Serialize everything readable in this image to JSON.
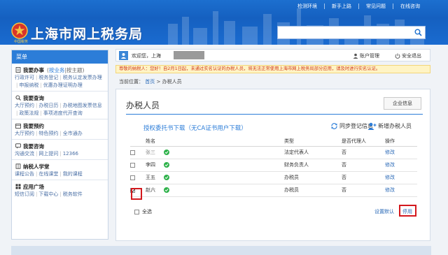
{
  "header": {
    "top_links": [
      "检测环境",
      "新手上路",
      "常见问题",
      "在线咨询"
    ],
    "title": "上海市网上税务局",
    "emblem_caption": "中国税务",
    "search_placeholder": ""
  },
  "sidebar": {
    "title": "菜单",
    "groups": [
      {
        "title": "我要办事",
        "tab_active": "按业务",
        "tab_other": "按主题",
        "links": [
          "行政许可",
          "税务登记",
          "税务认定",
          "发票办理",
          "申报纳税",
          "优惠办理",
          "证明办理"
        ]
      },
      {
        "title": "我要查询",
        "links": [
          "大厅预约",
          "办税日历",
          "办税地图",
          "发票信息",
          "政策法规",
          "事项进度",
          "代开查询"
        ]
      },
      {
        "title": "我要预约",
        "links": [
          "大厅预约",
          "特色预约",
          "全市通办"
        ]
      },
      {
        "title": "我要咨询",
        "links": [
          "沟通交流",
          "网上提问",
          "12366"
        ]
      },
      {
        "title": "纳税人学堂",
        "links": [
          "课程公告",
          "在线课堂",
          "我的课程"
        ]
      },
      {
        "title": "应用广场",
        "links": [
          "短信订阅",
          "下载中心",
          "税务软件"
        ]
      }
    ]
  },
  "welcome": {
    "text": "欢迎您，上海",
    "account_label": "账户管理",
    "logout_label": "安全退出"
  },
  "notice": "尊敬的纳税人：您好！自2月1日起，未通过实名认证的办税人员，将无法正常使用上海市网上税务局部分应用，请及时进行实名认证。",
  "breadcrumb": {
    "prefix": "当前位置：",
    "home": "首页",
    "sep": ">",
    "current": "办税人员"
  },
  "panel": {
    "title": "办税人员",
    "enterprise_button": "企业信息",
    "ca_link": "授权委托书下载（无CA证书用户下载）",
    "sync_label": "同步登记信息",
    "add_label": "新增办税人员",
    "columns": [
      "姓名",
      "类型",
      "是否代理人",
      "操作"
    ],
    "rows": [
      {
        "name": "张三",
        "type": "法定代表人",
        "agent": "否",
        "action": "修改",
        "checked": false
      },
      {
        "name": "李四",
        "type": "财务负责人",
        "agent": "否",
        "action": "修改",
        "checked": false
      },
      {
        "name": "王五",
        "type": "办税员",
        "agent": "否",
        "action": "修改",
        "checked": false
      },
      {
        "name": "赵六",
        "type": "办税员",
        "agent": "否",
        "action": "修改",
        "checked": true
      }
    ],
    "select_all": "全选",
    "set_default": "设置默认",
    "disable": "停用"
  },
  "colors": {
    "brand_blue": "#1c6fcf",
    "highlight_red": "#d3181d",
    "verified_green": "#2fb24b"
  }
}
